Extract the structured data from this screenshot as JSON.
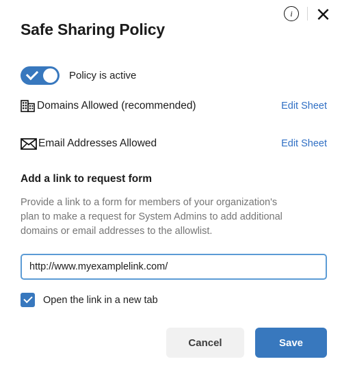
{
  "dialog": {
    "title": "Safe Sharing Policy",
    "info_icon": "info-circle-icon",
    "info_glyph": "i",
    "close_icon": "close-x-icon"
  },
  "toggle": {
    "label": "Policy is active",
    "state": "on",
    "color": "#3878be"
  },
  "rows": [
    {
      "icon": "building-icon",
      "label": "Domains Allowed (recommended)",
      "action_label": "Edit Sheet"
    },
    {
      "icon": "envelope-icon",
      "label": "Email Addresses Allowed",
      "action_label": "Edit Sheet"
    }
  ],
  "link_section": {
    "heading": "Add a link to request form",
    "description": "Provide a link to a form for members of your organization's plan to make a request for System Admins to add additional domains or email addresses to the allowlist.",
    "input_value": "http://www.myexamplelink.com/",
    "input_placeholder": "http://",
    "checkbox_label": "Open the link in a new tab",
    "checkbox_state": "checked"
  },
  "footer": {
    "cancel_label": "Cancel",
    "save_label": "Save"
  },
  "colors": {
    "accent_blue": "#3878be",
    "link_blue": "#2f6fc4",
    "focus_border": "#5b9bd5",
    "cancel_bg": "#f1f1f1",
    "text_primary": "#1c1c1c",
    "text_muted": "#757575"
  }
}
